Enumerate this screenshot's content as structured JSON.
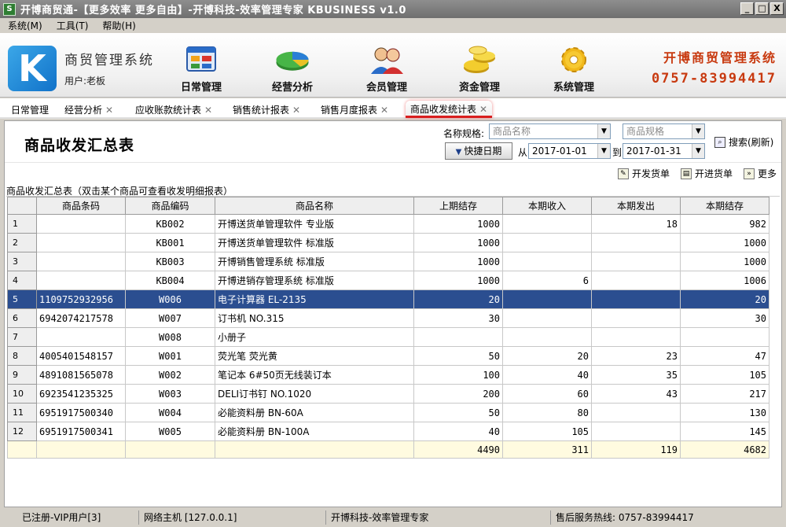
{
  "window": {
    "title": "开博商贸通-【更多效率 更多自由】-开博科技-效率管理专家  KBUSINESS v1.0",
    "controls": [
      "_",
      "□",
      "X"
    ]
  },
  "menu": [
    "系统(M)",
    "工具(T)",
    "帮助(H)"
  ],
  "header": {
    "system_name": "商贸管理系统",
    "user": "用户:老板",
    "nav": [
      {
        "label": "日常管理",
        "icon": "window-icon"
      },
      {
        "label": "经营分析",
        "icon": "pie-chart-icon"
      },
      {
        "label": "会员管理",
        "icon": "members-icon"
      },
      {
        "label": "资金管理",
        "icon": "coins-icon"
      },
      {
        "label": "系统管理",
        "icon": "gear-icon"
      }
    ],
    "brand_name": "开博商贸管理系统",
    "brand_phone": "0757-83994417"
  },
  "tabs": [
    {
      "label": "日常管理",
      "closable": false
    },
    {
      "label": "经营分析",
      "closable": true
    },
    {
      "label": "应收账款统计表",
      "closable": true
    },
    {
      "label": "销售统计报表",
      "closable": true
    },
    {
      "label": "销售月度报表",
      "closable": true
    },
    {
      "label": "商品收发统计表",
      "closable": true,
      "active": true
    }
  ],
  "page": {
    "title": "商品收发汇总表",
    "filters": {
      "name_spec_label": "名称规格:",
      "product_name_placeholder": "商品名称",
      "product_spec_placeholder": "商品规格",
      "quick_date_label": "快捷日期",
      "from_label": "从",
      "from_date": "2017-01-01",
      "to_label": "到",
      "to_date": "2017-01-31",
      "search_label": "搜索(刷新)"
    },
    "toolbar": {
      "issue_label": "开发货单",
      "receive_label": "开进货单",
      "more_label": "更多"
    },
    "grid_caption": "商品收发汇总表（双击某个商品可查看收发明细报表）"
  },
  "table": {
    "columns": [
      "",
      "商品条码",
      "商品编码",
      "商品名称",
      "上期结存",
      "本期收入",
      "本期发出",
      "本期结存"
    ],
    "rows": [
      [
        "1",
        "",
        "KB002",
        "开博送货单管理软件 专业版",
        "1000",
        "",
        "18",
        "982"
      ],
      [
        "2",
        "",
        "KB001",
        "开博送货单管理软件 标准版",
        "1000",
        "",
        "",
        "1000"
      ],
      [
        "3",
        "",
        "KB003",
        "开博销售管理系统 标准版",
        "1000",
        "",
        "",
        "1000"
      ],
      [
        "4",
        "",
        "KB004",
        "开博进销存管理系统 标准版",
        "1000",
        "6",
        "",
        "1006"
      ],
      [
        "5",
        "1109752932956",
        "W006",
        "电子计算器 EL-2135",
        "20",
        "",
        "",
        "20"
      ],
      [
        "6",
        "6942074217578",
        "W007",
        "订书机 NO.315",
        "30",
        "",
        "",
        "30"
      ],
      [
        "7",
        "",
        "W008",
        "小册子",
        "",
        "",
        "",
        ""
      ],
      [
        "8",
        "4005401548157",
        "W001",
        "荧光笔 荧光黄",
        "50",
        "20",
        "23",
        "47"
      ],
      [
        "9",
        "4891081565078",
        "W002",
        "笔记本 6#50页无线装订本",
        "100",
        "40",
        "35",
        "105"
      ],
      [
        "10",
        "6923541235325",
        "W003",
        "DELI订书钉 NO.1020",
        "200",
        "60",
        "43",
        "217"
      ],
      [
        "11",
        "6951917500340",
        "W004",
        "必能资料册 BN-60A",
        "50",
        "80",
        "",
        "130"
      ],
      [
        "12",
        "6951917500341",
        "W005",
        "必能资料册 BN-100A",
        "40",
        "105",
        "",
        "145"
      ]
    ],
    "selected_row": 4,
    "totals": [
      "",
      "",
      "",
      "",
      "4490",
      "311",
      "119",
      "4682"
    ]
  },
  "status": {
    "registered": "已注册-VIP用户[3]",
    "host": "网络主机 [127.0.0.1]",
    "company": "开博科技-效率管理专家",
    "hotline": "售后服务热线: 0757-83994417"
  }
}
